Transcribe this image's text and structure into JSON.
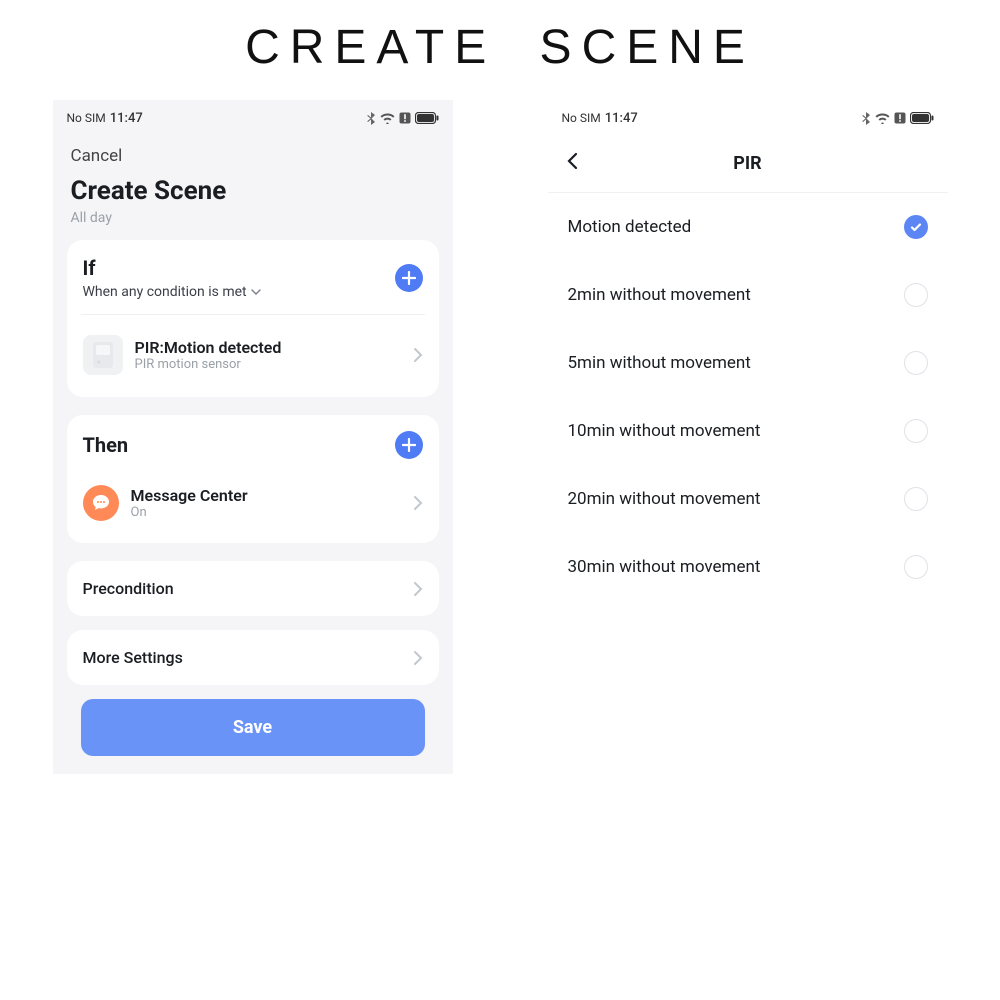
{
  "page_heading": "CREATE  SCENE",
  "status": {
    "carrier": "No SIM",
    "time": "11:47"
  },
  "left": {
    "cancel": "Cancel",
    "title": "Create Scene",
    "subtitle": "All day",
    "if_card": {
      "title": "If",
      "subtitle": "When any condition is met",
      "item_title": "PIR:Motion detected",
      "item_sub": "PIR motion sensor"
    },
    "then_card": {
      "title": "Then",
      "item_title": "Message Center",
      "item_sub": "On"
    },
    "precondition": "Precondition",
    "more_settings": "More Settings",
    "save": "Save"
  },
  "right": {
    "title": "PIR",
    "options": [
      {
        "label": "Motion detected",
        "selected": true
      },
      {
        "label": "2min without movement",
        "selected": false
      },
      {
        "label": "5min without movement",
        "selected": false
      },
      {
        "label": "10min without movement",
        "selected": false
      },
      {
        "label": "20min without movement",
        "selected": false
      },
      {
        "label": "30min without movement",
        "selected": false
      }
    ]
  }
}
